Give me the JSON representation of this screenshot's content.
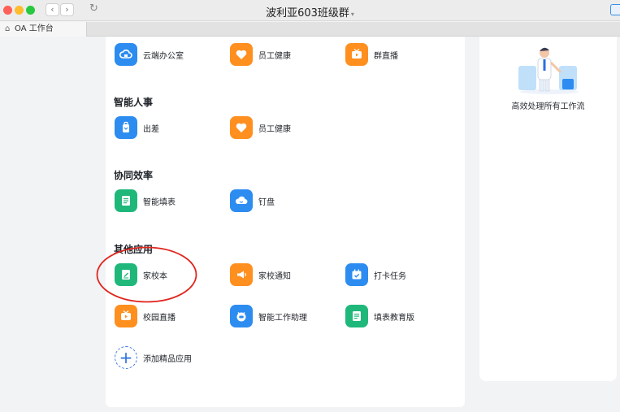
{
  "window": {
    "title": "波利亚603班级群",
    "tab": "OA 工作台"
  },
  "sections": {
    "top": {
      "apps": [
        {
          "label": "云端办公室",
          "icon": "cloud-office-icon",
          "color": "#2d8cf0"
        },
        {
          "label": "员工健康",
          "icon": "heart-icon",
          "color": "#ff8f1f"
        },
        {
          "label": "群直播",
          "icon": "live-tv-icon",
          "color": "#ff8f1f"
        }
      ]
    },
    "hr": {
      "title": "智能人事",
      "apps": [
        {
          "label": "出差",
          "icon": "luggage-icon",
          "color": "#2d8cf0"
        },
        {
          "label": "员工健康",
          "icon": "heart-icon",
          "color": "#ff8f1f"
        }
      ]
    },
    "collab": {
      "title": "协同效率",
      "apps": [
        {
          "label": "智能填表",
          "icon": "form-icon",
          "color": "#1fb87a"
        },
        {
          "label": "钉盘",
          "icon": "cloud-drive-icon",
          "color": "#2d8cf0"
        }
      ]
    },
    "other": {
      "title": "其他应用",
      "apps": [
        {
          "label": "家校本",
          "icon": "homework-icon",
          "color": "#1fb87a"
        },
        {
          "label": "家校通知",
          "icon": "megaphone-icon",
          "color": "#ff8f1f"
        },
        {
          "label": "打卡任务",
          "icon": "calendar-check-icon",
          "color": "#2d8cf0"
        },
        {
          "label": "校园直播",
          "icon": "live-tv-icon",
          "color": "#ff8f1f"
        },
        {
          "label": "智能工作助理",
          "icon": "robot-icon",
          "color": "#2d8cf0"
        },
        {
          "label": "填表教育版",
          "icon": "form-icon",
          "color": "#1fb87a"
        }
      ],
      "add_label": "添加精品应用"
    }
  },
  "side": {
    "caption": "高效处理所有工作流"
  },
  "annotation_color": "#e0261e"
}
